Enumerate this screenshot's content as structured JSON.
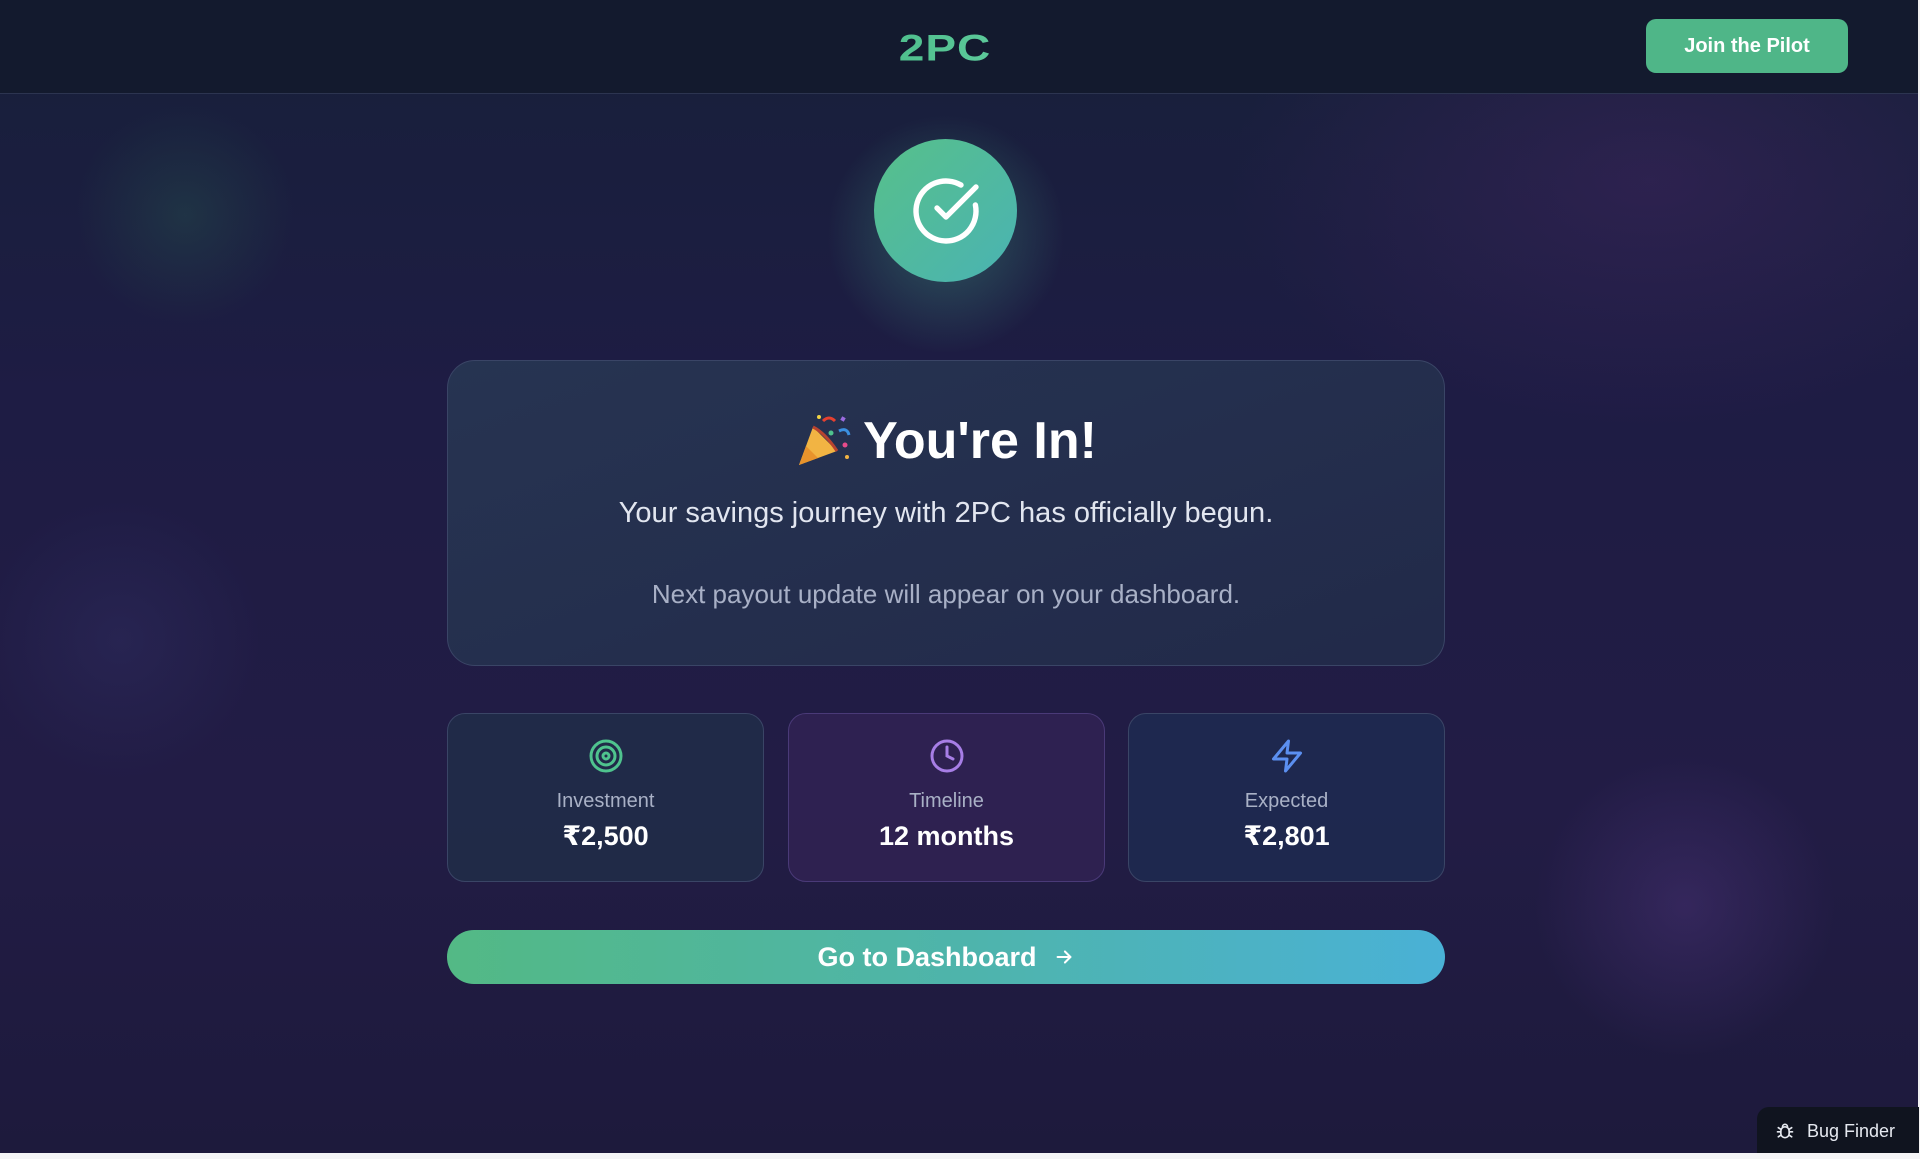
{
  "header": {
    "logo_text": "2PC",
    "join_button_label": "Join the Pilot"
  },
  "success": {
    "emoji": "🎉",
    "title": "You're In!",
    "subtitle": "Your savings journey with 2PC has officially begun.",
    "note": "Next payout update will appear on your dashboard."
  },
  "stats": [
    {
      "icon": "target-icon",
      "label": "Investment",
      "value": "₹2,500"
    },
    {
      "icon": "clock-icon",
      "label": "Timeline",
      "value": "12 months"
    },
    {
      "icon": "lightning-icon",
      "label": "Expected",
      "value": "₹2,801"
    }
  ],
  "dashboard_button_label": "Go to Dashboard",
  "bug_finder_label": "Bug Finder",
  "colors": {
    "accent_green": "#4fb688",
    "accent_teal": "#4ab1d6",
    "background": "#1c1a3c",
    "investment_icon": "#4fc38e",
    "timeline_icon": "#a77ee6",
    "expected_icon": "#5b8ff0"
  }
}
